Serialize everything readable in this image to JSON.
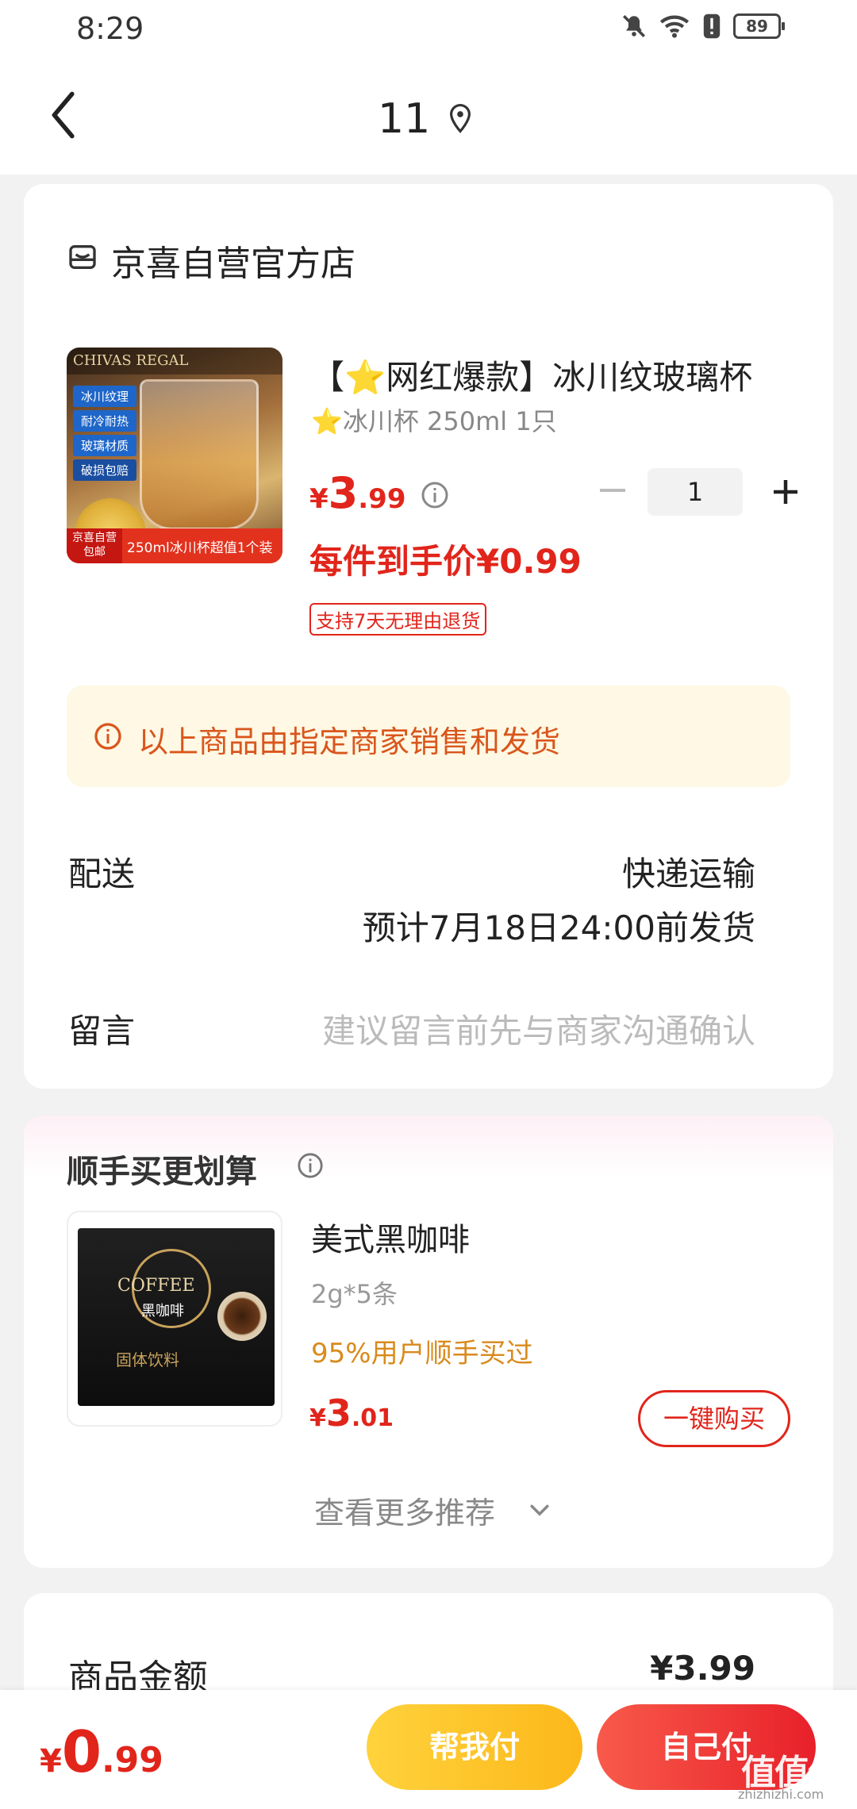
{
  "status_bar": {
    "time": "8:29",
    "battery": "89"
  },
  "header": {
    "title": "11"
  },
  "store": {
    "name": "京喜自营官方店"
  },
  "product": {
    "image_brand": "CHIVAS REGAL",
    "image_tags": [
      "冰川纹理",
      "耐冷耐热",
      "玻璃材质",
      "破损包赔"
    ],
    "image_badge": "京喜自营 包邮",
    "image_footer": "250ml冰川杯超值1个装",
    "title": "【⭐网红爆款】冰川纹玻璃杯",
    "spec": "⭐冰川杯 250ml 1只",
    "price_symbol": "¥",
    "price_int": "3",
    "price_dec": ".99",
    "quantity": "1",
    "deal_price": "每件到手价¥0.99",
    "return_policy": "支持7天无理由退货"
  },
  "notice": {
    "text": "以上商品由指定商家销售和发货"
  },
  "delivery": {
    "label": "配送",
    "method": "快递运输",
    "eta": "预计7月18日24:00前发货"
  },
  "message": {
    "label": "留言",
    "placeholder": "建议留言前先与商家沟通确认"
  },
  "recommend": {
    "title": "顺手买更划算",
    "item": {
      "image_text_en": "COFFEE",
      "image_text_cn": "黑咖啡",
      "image_text_type": "固体饮料",
      "name": "美式黑咖啡",
      "spec": "2g*5条",
      "bought": "95%用户顺手买过",
      "price_symbol": "¥",
      "price_int": "3",
      "price_dec": ".01",
      "buy_label": "一键购买"
    },
    "more_label": "查看更多推荐"
  },
  "summary": {
    "label": "商品金额",
    "value": "¥3.99"
  },
  "bottom": {
    "price_symbol": "¥",
    "price_int": "0",
    "price_dec": ".99",
    "help_pay": "帮我付",
    "self_pay": "自己付"
  },
  "watermark": {
    "main": "值值值",
    "sub": "zhizhizhi.com"
  },
  "colors": {
    "accent_red": "#e1251b",
    "notice_bg": "#fef8e4",
    "notice_text": "#d9561c",
    "help_btn": "#fcb81a"
  }
}
